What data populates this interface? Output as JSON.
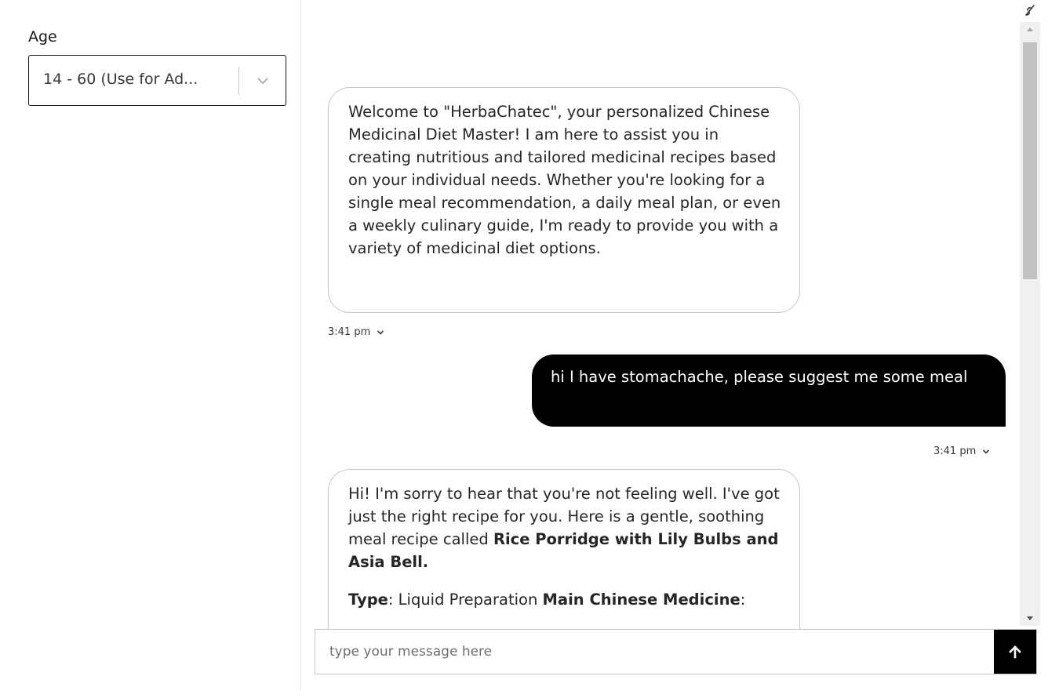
{
  "sidebar": {
    "age_label": "Age",
    "age_select": {
      "value": "14 - 60 (Use for Ad...",
      "chevron_icon": "chevron-down-icon"
    }
  },
  "chat": {
    "messages": [
      {
        "sender": "bot",
        "paragraphs": [
          "Welcome to \"HerbaChatec\", your personalized Chinese Medicinal Diet Master! I am here to assist you in creating nutritious and tailored medicinal recipes based on your individual needs. Whether you're looking for a single meal recommendation, a daily meal plan, or even a weekly culinary guide, I'm ready to provide you with a variety of medicinal diet options."
        ],
        "time": "3:41 pm"
      },
      {
        "sender": "user",
        "text": "hi I have stomachache, please suggest me some meal",
        "time": "3:41 pm"
      },
      {
        "sender": "bot",
        "intro": "Hi! I'm sorry to hear that you're not feeling well. I've got just the right recipe for you. Here is a gentle, soothing meal recipe called ",
        "recipe_name": "Rice Porridge with Lily Bulbs and Asia Bell.",
        "type_label": "Type",
        "type_value": ": Liquid Preparation ",
        "medicine_label": "Main Chinese Medicine",
        "medicine_value": ":"
      }
    ],
    "input": {
      "placeholder": "type your message here",
      "value": ""
    },
    "send_icon": "arrow-up-icon",
    "corner_icon": "link-icon"
  },
  "colors": {
    "user_bubble": "#000000",
    "bot_bubble_border": "#c6c6c6",
    "send_button": "#000000"
  }
}
